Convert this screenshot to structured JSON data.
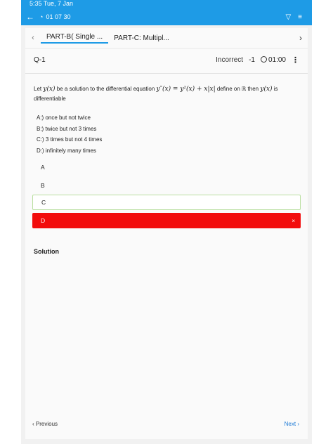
{
  "status_bar": {
    "time_text": "5:35 Tue, 7 Jan"
  },
  "app_bar": {
    "back_icon": "arrow-left-icon",
    "timer_text": "01 07 30"
  },
  "tabs": [
    {
      "label": "PART-B( Single ..."
    },
    {
      "label": "PART-C: Multipl..."
    }
  ],
  "question": {
    "number": "Q-1",
    "result": "Incorrect",
    "marks": "-1",
    "time": "01:00",
    "text_before_fn": "Let",
    "fn": "y(x)",
    "text_mid": "be a solution to the differential equation",
    "equation": "y″(x) = y²(x) + x|x|",
    "text_domain": "define on ℝ then",
    "fn2": "y(x)",
    "text_end": "is differentiable",
    "options": [
      {
        "label": "A:)",
        "text": "once but not twice"
      },
      {
        "label": "B:)",
        "text": "twice but not 3 times"
      },
      {
        "label": "C:)",
        "text": "3 times but not 4 times"
      },
      {
        "label": "D:)",
        "text": "infinitely many times"
      }
    ]
  },
  "choices": [
    {
      "label": "A",
      "state": "plain"
    },
    {
      "label": "B",
      "state": "plain"
    },
    {
      "label": "C",
      "state": "correct"
    },
    {
      "label": "D",
      "state": "wrong",
      "mark": "×"
    }
  ],
  "solution_label": "Solution",
  "footer": {
    "previous": "Previous",
    "next": "Next"
  },
  "colors": {
    "accent": "#1e9be6",
    "wrong": "#f20d0d",
    "correct_border": "#b9dfa0"
  }
}
